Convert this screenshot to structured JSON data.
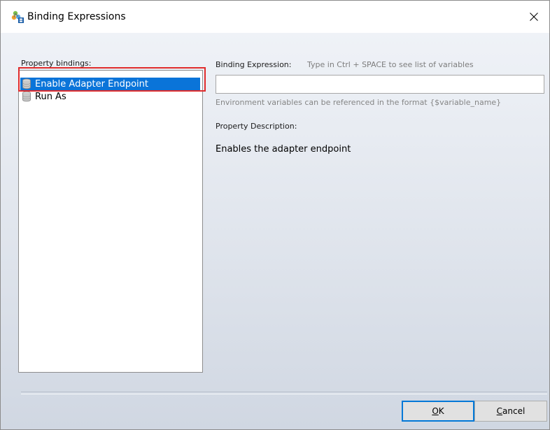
{
  "window": {
    "title": "Binding Expressions"
  },
  "icons": {
    "app": "binding-expressions-app-icon",
    "close": "close-icon",
    "item": "database-icon"
  },
  "colors": {
    "selection": "#0a74d9",
    "highlight_border": "#e02c2c",
    "ok_button_border": "#0078d7"
  },
  "left_panel": {
    "label": "Property bindings:",
    "items": [
      {
        "label": "Enable Adapter Endpoint",
        "selected": true
      },
      {
        "label": "Run As",
        "selected": false
      }
    ]
  },
  "right_panel": {
    "binding_expression_label": "Binding Expression:",
    "binding_expression_hint": "Type in Ctrl + SPACE to see list of variables",
    "binding_expression_value": "",
    "env_hint": "Environment variables can be referenced in the format {$variable_name}",
    "property_description_label": "Property Description:",
    "property_description_text": "Enables the adapter endpoint"
  },
  "footer": {
    "ok_mnemonic": "O",
    "ok_rest": "K",
    "cancel_mnemonic": "C",
    "cancel_rest": "ancel"
  }
}
